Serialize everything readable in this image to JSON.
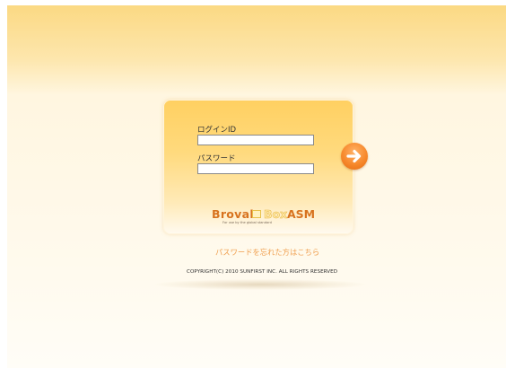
{
  "login": {
    "id_label": "ログインID",
    "id_value": "",
    "password_label": "パスワード",
    "password_value": "",
    "submit_icon": "arrow-right-icon"
  },
  "logo": {
    "brand_left": "Broval",
    "brand_box": "Box",
    "brand_product": "ASM",
    "tagline": "For use by the global standard"
  },
  "forgot_password_link": "パスワードを忘れた方はこちら",
  "copyright": "COPYRIGHT(C) 2010 SUNFIRST INC. ALL RIGHTS RESERVED",
  "colors": {
    "accent_orange": "#f7892c",
    "link_orange": "#f0a050",
    "card_yellow": "#ffd061"
  }
}
